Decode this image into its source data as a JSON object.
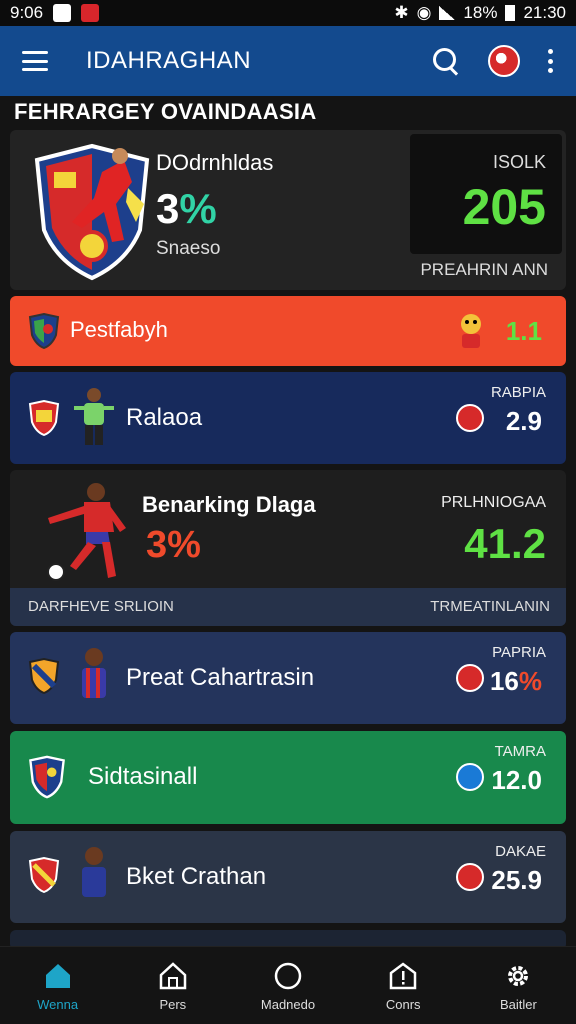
{
  "status_bar": {
    "time_left": "9:06",
    "battery": "18%",
    "time_right": "21:30"
  },
  "app_bar": {
    "title": "IDAHRAGHAN"
  },
  "section": {
    "title": "FEHRARGEY OVAINDAASIA"
  },
  "featured": {
    "name": "DOdrnhldas",
    "percent_num": "3",
    "percent_sign": "%",
    "subtitle": "Snaeso",
    "score_label": "ISOLK",
    "score": "205",
    "footer": "PREAHRIN ANN"
  },
  "rows": [
    {
      "label": "Pestfabyh",
      "value": "1.1"
    },
    {
      "label": "Ralaoa",
      "small": "RABPIA",
      "value": "2.9"
    },
    {
      "label": "Benarking Dlaga",
      "percent": "3%",
      "small": "PRLHNIOGAA",
      "value": "41.2",
      "footer_left": "DARFHEVE SRLIOIN",
      "footer_right": "TRMEATINLANIN"
    },
    {
      "label": "Preat Cahartrasin",
      "small": "PAPRIA",
      "value_num": "16",
      "value_pct": "%"
    },
    {
      "label": "Sidtasinall",
      "small": "TAMRA",
      "value": "12.0"
    },
    {
      "label": "Bket Crathan",
      "small": "DAKAE",
      "value": "25.9"
    }
  ],
  "nav": [
    {
      "label": "Wenna",
      "icon": "home-icon"
    },
    {
      "label": "Pers",
      "icon": "house-outline-icon"
    },
    {
      "label": "Madnedo",
      "icon": "circle-icon"
    },
    {
      "label": "Conrs",
      "icon": "alert-icon"
    },
    {
      "label": "Baitler",
      "icon": "gear-icon"
    }
  ],
  "colors": {
    "app_bar": "#134a8e",
    "accent_green": "#5fe144",
    "accent_orange": "#f04a2b",
    "accent_teal": "#1ea5c8"
  }
}
